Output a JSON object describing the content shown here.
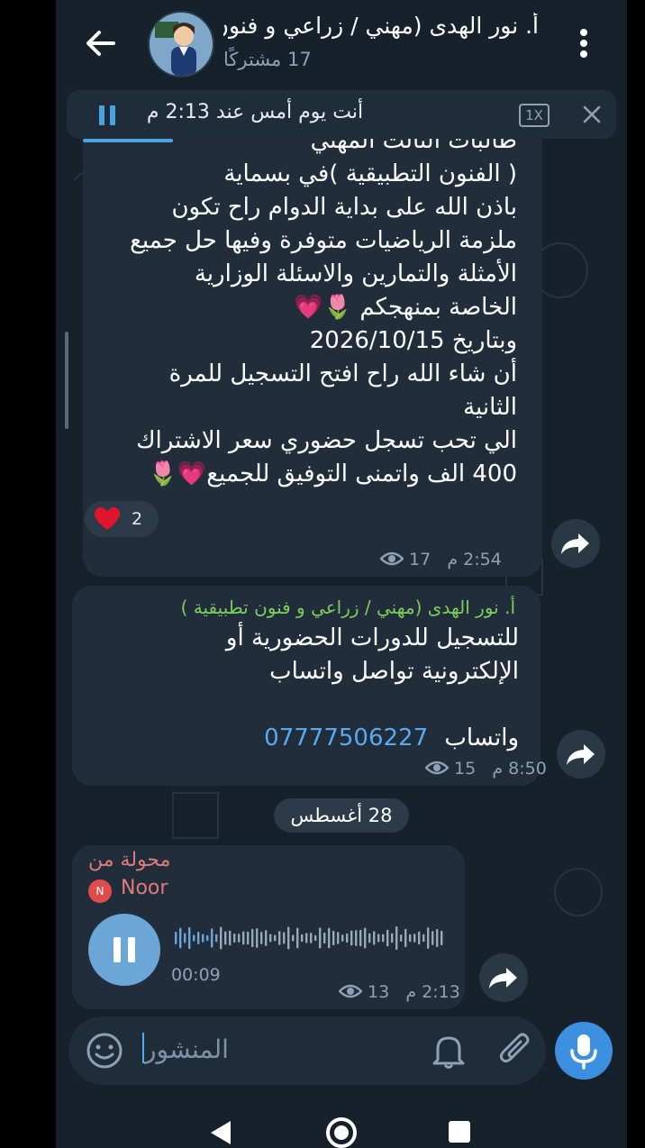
{
  "header": {
    "title": "أ. نور الهدى (مهني / زراعي و فنون تطبيقية )",
    "subscribers": "17 مشتركًا"
  },
  "player": {
    "text": "أنت يوم أمس عند 2:13 م",
    "speed": "1X"
  },
  "messages": [
    {
      "lines": [
        "طالبات الثالث المهني",
        "( الفنون التطبيقية )في بسماية",
        "باذن الله على بداية الدوام راح تكون",
        "ملزمة الرياضيات متوفرة وفيها حل جميع",
        "الأمثلة والتمارين  والاسئلة الوزارية",
        "الخاصة بمنهجكم 🌷💗",
        "وبتاريخ 2026/10/15",
        "أن شاء الله راح افتح التسجيل للمرة",
        "الثانية",
        "الي تحب تسجل حضوري سعر الاشتراك",
        "400 الف واتمنى التوفيق للجميع💗🌷"
      ],
      "reaction": {
        "emoji": "❤️",
        "count": "2"
      },
      "views": "17",
      "time": "2:54 م"
    },
    {
      "sender": "أ. نور الهدى (مهني / زراعي و فنون تطبيقية )",
      "lines": [
        "للتسجيل للدورات الحضورية أو",
        "الإلكترونية تواصل واتساب",
        "",
        "واتساب"
      ],
      "phone": "07777506227",
      "views": "15",
      "time": "8:50 م"
    }
  ],
  "date_separator": "28 أغسطس",
  "voice_message": {
    "forwarded_label": "محولة من",
    "forwarded_from": "Noor",
    "avatar_initial": "N",
    "duration": "00:09",
    "views": "13",
    "time": "2:13 م"
  },
  "input": {
    "placeholder": "المنشور"
  },
  "colors": {
    "background": "#17212b",
    "bubble": "#212d3b",
    "accent": "#3d8fe0",
    "link": "#5aa9ef",
    "sender_name": "#7ccf5a",
    "forwarded": "#e07b7b"
  },
  "icons": [
    "back-arrow-icon",
    "more-vert-icon",
    "pause-icon",
    "close-icon",
    "share-icon",
    "heart-icon",
    "eye-icon",
    "emoji-icon",
    "bell-icon",
    "paperclip-icon",
    "mic-icon",
    "nav-back-icon",
    "nav-home-icon",
    "nav-recents-icon"
  ]
}
